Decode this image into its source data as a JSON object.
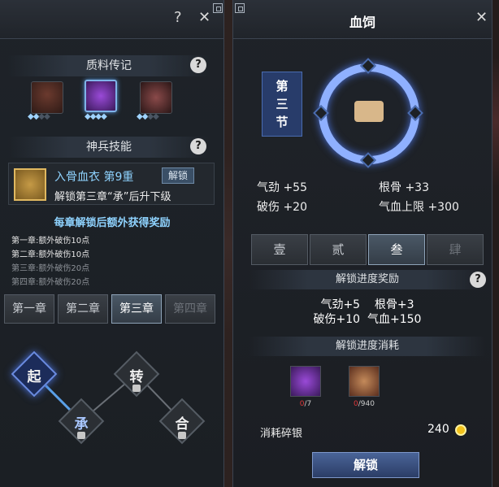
{
  "left_panel": {
    "help_btn": "?",
    "close_btn": "✕",
    "materials_title": "质料传记",
    "skills_title": "神兵技能",
    "skill": {
      "name": "入骨血衣 第9重",
      "unlock_btn": "解锁",
      "desc": "解锁第三章“承”后升下级"
    },
    "reward_heading": "每章解锁后额外获得奖励",
    "rewards": [
      "第一章:额外破伤10点",
      "第二章:额外破伤10点",
      "第三章:额外破伤20点",
      "第四章:额外破伤20点"
    ],
    "chapters": [
      "第一章",
      "第二章",
      "第三章",
      "第四章"
    ],
    "nodes": [
      "起",
      "承",
      "转",
      "合"
    ]
  },
  "right_panel": {
    "title": "血饲",
    "close_btn": "✕",
    "section_chars": [
      "第",
      "三",
      "节"
    ],
    "stats": {
      "a": "气劲 +55",
      "b": "根骨 +33",
      "c": "破伤 +20",
      "d": "气血上限 +300"
    },
    "tabs": [
      "壹",
      "贰",
      "叁",
      "肆"
    ],
    "reward_title": "解锁进度奖励",
    "reward_lines": [
      "气劲+5    根骨+3",
      "破伤+10  气血+150"
    ],
    "cost_title": "解锁进度消耗",
    "costs": [
      {
        "have": "0",
        "need": "/7"
      },
      {
        "have": "0",
        "need": "/940"
      }
    ],
    "silver_label": "消耗碎银",
    "silver_value": "240",
    "unlock_btn": "解锁"
  },
  "colors": {
    "accent_blue": "#8fb0ff",
    "title_cyan": "#8fd3ff",
    "reward_red": "#e0393a",
    "coin_gold": "#f3c21b"
  }
}
